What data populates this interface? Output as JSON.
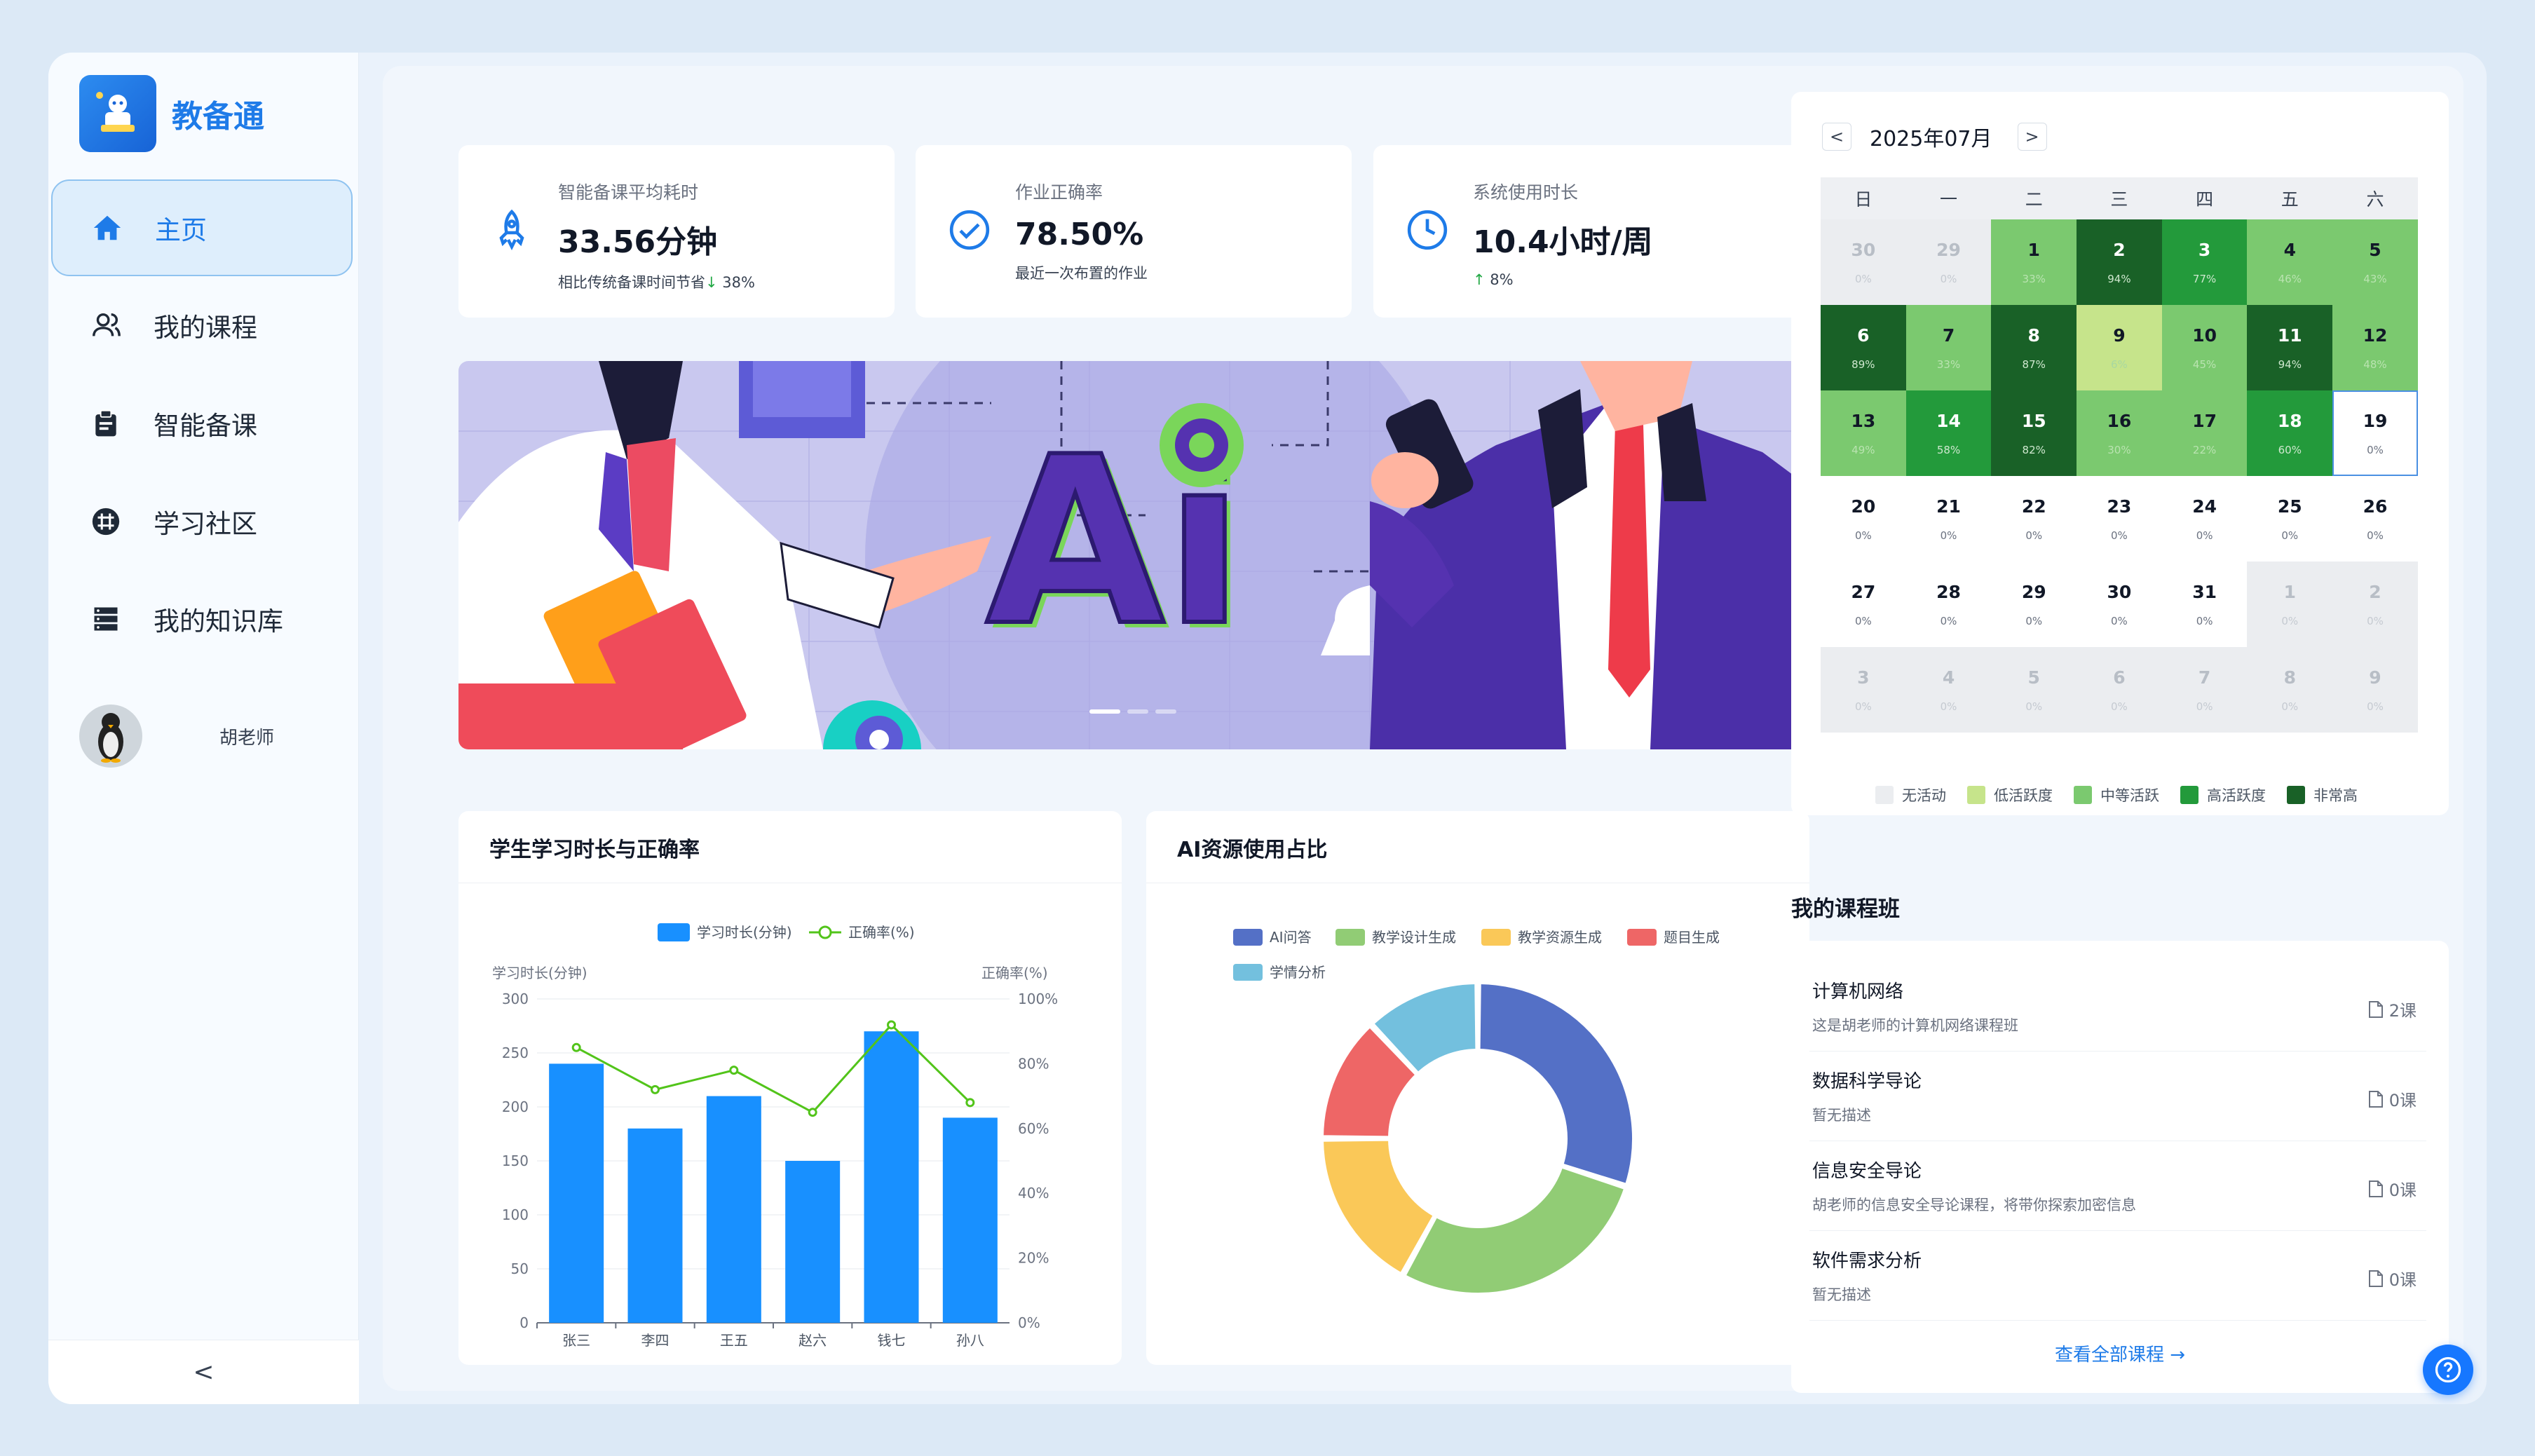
{
  "app": {
    "name": "教备通"
  },
  "sidebar": {
    "items": [
      {
        "label": "主页",
        "icon": "home-icon"
      },
      {
        "label": "我的课程",
        "icon": "users-icon"
      },
      {
        "label": "智能备课",
        "icon": "clipboard-icon"
      },
      {
        "label": "学习社区",
        "icon": "community-icon"
      },
      {
        "label": "我的知识库",
        "icon": "database-icon"
      }
    ],
    "user": {
      "name": "胡老师"
    },
    "collapse_label": "<"
  },
  "stats": [
    {
      "label": "智能备课平均耗时",
      "value": "33.56分钟",
      "sub": "相比传统备课时间节省",
      "change": "38%",
      "icon": "rocket-icon"
    },
    {
      "label": "作业正确率",
      "value": "78.50%",
      "sub": "最近一次布置的作业",
      "icon": "check-circle-icon"
    },
    {
      "label": "系统使用时长",
      "value": "10.4小时/周",
      "change": "8%",
      "icon": "clock-icon"
    }
  ],
  "banner": {
    "text": "Ai"
  },
  "bar_chart": {
    "title": "学生学习时长与正确率"
  },
  "pie_chart": {
    "title": "AI资源使用占比"
  },
  "chart_data": [
    {
      "type": "bar",
      "title": "学生学习时长与正确率",
      "categories": [
        "张三",
        "李四",
        "王五",
        "赵六",
        "钱七",
        "孙八"
      ],
      "series": [
        {
          "name": "学习时长(分钟)",
          "type": "bar",
          "values": [
            240,
            180,
            210,
            150,
            270,
            190
          ],
          "color": "#1890ff"
        },
        {
          "name": "正确率(%)",
          "type": "line",
          "values": [
            85,
            72,
            78,
            65,
            92,
            68
          ],
          "color": "#52c41a"
        }
      ],
      "ylabel": "学习时长(分钟)",
      "y2label": "正确率(%)",
      "ylim": [
        0,
        300
      ],
      "y2lim": [
        0,
        100
      ],
      "yticks": [
        "300",
        "250",
        "200",
        "150",
        "100",
        "50",
        "0"
      ],
      "y2ticks": [
        "100%",
        "80%",
        "60%",
        "40%",
        "20%",
        "0%"
      ],
      "legend": "top-center"
    },
    {
      "type": "pie",
      "title": "AI资源使用占比",
      "categories": [
        "AI问答",
        "教学设计生成",
        "教学资源生成",
        "题目生成",
        "学情分析"
      ],
      "values": [
        30,
        28,
        17,
        13,
        12
      ],
      "colors": [
        "#5470c6",
        "#91cc75",
        "#fac858",
        "#ee6666",
        "#73c0de"
      ],
      "legend": "top"
    }
  ],
  "calendar": {
    "title": "2025年07月",
    "prev": "<",
    "next": ">",
    "weekdays": [
      "日",
      "一",
      "二",
      "三",
      "四",
      "五",
      "六"
    ],
    "cells": [
      {
        "d": "30",
        "p": "0%",
        "lvl": "out"
      },
      {
        "d": "29",
        "p": "0%",
        "lvl": "out"
      },
      {
        "d": "1",
        "p": "33%",
        "lvl": 2
      },
      {
        "d": "2",
        "p": "94%",
        "lvl": 4
      },
      {
        "d": "3",
        "p": "77%",
        "lvl": 3
      },
      {
        "d": "4",
        "p": "46%",
        "lvl": 2
      },
      {
        "d": "5",
        "p": "43%",
        "lvl": 2
      },
      {
        "d": "6",
        "p": "89%",
        "lvl": 4
      },
      {
        "d": "7",
        "p": "33%",
        "lvl": 2
      },
      {
        "d": "8",
        "p": "87%",
        "lvl": 4
      },
      {
        "d": "9",
        "p": "6%",
        "lvl": 1
      },
      {
        "d": "10",
        "p": "45%",
        "lvl": 2
      },
      {
        "d": "11",
        "p": "94%",
        "lvl": 4
      },
      {
        "d": "12",
        "p": "48%",
        "lvl": 2
      },
      {
        "d": "13",
        "p": "49%",
        "lvl": 2
      },
      {
        "d": "14",
        "p": "58%",
        "lvl": 3
      },
      {
        "d": "15",
        "p": "82%",
        "lvl": 4
      },
      {
        "d": "16",
        "p": "30%",
        "lvl": 2
      },
      {
        "d": "17",
        "p": "22%",
        "lvl": 2
      },
      {
        "d": "18",
        "p": "60%",
        "lvl": 3
      },
      {
        "d": "19",
        "p": "0%",
        "lvl": "today"
      },
      {
        "d": "20",
        "p": "0%",
        "lvl": 0
      },
      {
        "d": "21",
        "p": "0%",
        "lvl": 0
      },
      {
        "d": "22",
        "p": "0%",
        "lvl": 0
      },
      {
        "d": "23",
        "p": "0%",
        "lvl": 0
      },
      {
        "d": "24",
        "p": "0%",
        "lvl": 0
      },
      {
        "d": "25",
        "p": "0%",
        "lvl": 0
      },
      {
        "d": "26",
        "p": "0%",
        "lvl": 0
      },
      {
        "d": "27",
        "p": "0%",
        "lvl": 0
      },
      {
        "d": "28",
        "p": "0%",
        "lvl": 0
      },
      {
        "d": "29",
        "p": "0%",
        "lvl": 0
      },
      {
        "d": "30",
        "p": "0%",
        "lvl": 0
      },
      {
        "d": "31",
        "p": "0%",
        "lvl": 0
      },
      {
        "d": "1",
        "p": "0%",
        "lvl": "out"
      },
      {
        "d": "2",
        "p": "0%",
        "lvl": "out"
      },
      {
        "d": "3",
        "p": "0%",
        "lvl": "out"
      },
      {
        "d": "4",
        "p": "0%",
        "lvl": "out"
      },
      {
        "d": "5",
        "p": "0%",
        "lvl": "out"
      },
      {
        "d": "6",
        "p": "0%",
        "lvl": "out"
      },
      {
        "d": "7",
        "p": "0%",
        "lvl": "out"
      },
      {
        "d": "8",
        "p": "0%",
        "lvl": "out"
      },
      {
        "d": "9",
        "p": "0%",
        "lvl": "out"
      }
    ],
    "legend": [
      {
        "label": "无活动",
        "color": "#ebedf0"
      },
      {
        "label": "低活跃度",
        "color": "#c6e48b"
      },
      {
        "label": "中等活跃",
        "color": "#7bc96f"
      },
      {
        "label": "高活跃度",
        "color": "#239a3b"
      },
      {
        "label": "非常高",
        "color": "#196127"
      }
    ]
  },
  "courses": {
    "title": "我的课程班",
    "items": [
      {
        "name": "计算机网络",
        "desc": "这是胡老师的计算机网络课程班",
        "count": "2课"
      },
      {
        "name": "数据科学导论",
        "desc": "暂无描述",
        "count": "0课"
      },
      {
        "name": "信息安全导论",
        "desc": "胡老师的信息安全导论课程，将带你探索加密信息",
        "count": "0课"
      },
      {
        "name": "软件需求分析",
        "desc": "暂无描述",
        "count": "0课"
      }
    ],
    "view_all": "查看全部课程 →"
  }
}
